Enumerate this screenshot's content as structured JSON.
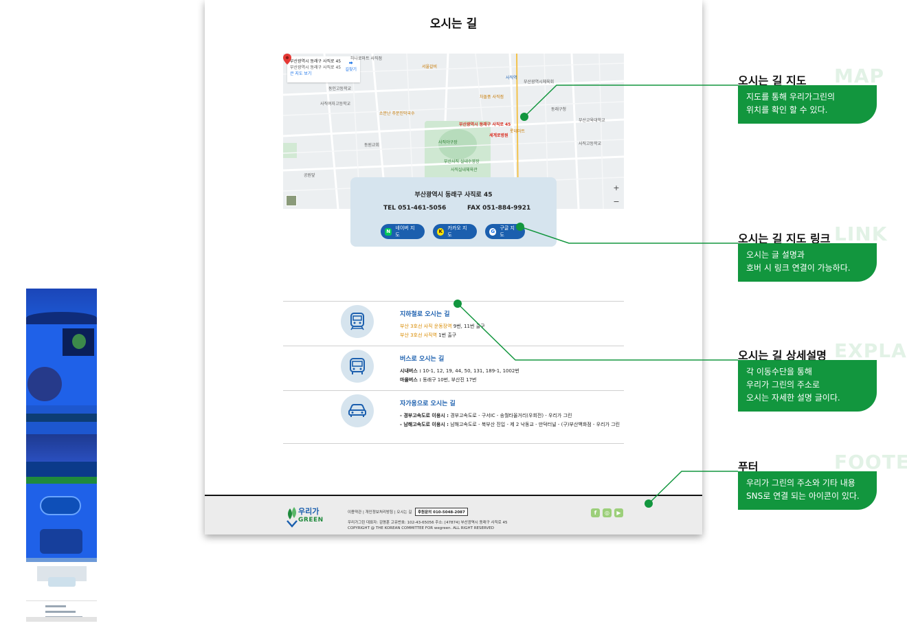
{
  "page": {
    "title": "오시는 길",
    "map": {
      "address_box": {
        "line1": "부산광역시 동래구 사직로 45",
        "line2": "부산광역시 동래구 사직로 45",
        "larger_map": "큰 지도 보기",
        "directions": "길찾기"
      },
      "labels": {
        "pin": "부산광역시 동래구 사직로 45",
        "a": "하나로마트 사직점",
        "b": "사직여자고등학교",
        "c": "동인고등학교",
        "d": "사직역",
        "e": "사직야구장",
        "f": "부산사직 실내수영장",
        "g": "사직실내체육관",
        "h": "세계로병원",
        "i": "서울갈비",
        "j": "차돌풍 사직점",
        "k": "소문난 주문진막국수",
        "l": "부산교육대학교",
        "m": "동래구청",
        "n": "부산광역시체육회",
        "o": "롯데마트",
        "p": "사직고등학교",
        "q": "공원앞",
        "r": "동원교회"
      },
      "zoom_in": "+",
      "zoom_out": "−"
    },
    "info": {
      "address": "부산광역시 동래구 사직로 45",
      "tel": "TEL 051-461-5056",
      "fax": "FAX 051-884-9921",
      "buttons": {
        "naver": "네이버 지도",
        "naver_icon": "N",
        "kakao": "카카오 지도",
        "kakao_icon": "K",
        "google": "구글 지도",
        "google_icon": "G"
      }
    },
    "routes": {
      "subway": {
        "title": "지하철로 오시는 길",
        "line1_hl": "부산 3호선 사직 운동장역",
        "line1_rest": " 9번, 11번 출구",
        "line2_hl": "부산 3호선 사직역",
        "line2_rest": " 1번 출구"
      },
      "bus": {
        "title": "버스로 오시는 길",
        "line1_label": "시내버스 :",
        "line1_rest": " 10-1, 12, 19, 44, 50, 131, 189-1, 1002번",
        "line2_label": "마을버스 :",
        "line2_rest": " 동래구 10번, 부산진 17번"
      },
      "car": {
        "title": "자가용으로 오시는 길",
        "line1_label": "- 경부고속도로 이용시 :",
        "line1_rest": " 경부고속도로 - 구서IC - 송월타올거리(우회전) - 우리가 그린",
        "line2_label": "- 남해고속도로 이용시 :",
        "line2_rest": " 남해고속도로 - 북부산 진입 - 제 2 낙동교 - 만덕터널 - (구)부산백화점 - 우리가 그린"
      }
    },
    "footer": {
      "logo_line1": "우리가",
      "logo_line2": "GREEN",
      "links": "이용약관 | 개인정보처리방침 | 오시는 길",
      "phone": "후원문의 010-5048-2087",
      "address": "우리가그린  대표자: 김명훈  고유번호: 102-43-65056  주소: [47874]  부산광역시 동래구 사직로 45",
      "copyright": "COPYRIGHT @ THE KOREAN COMMITTEE FOR wegreen. ALL RIGHT RESERVED",
      "sns": {
        "facebook": "f",
        "instagram": "◎",
        "youtube": "▶"
      }
    }
  },
  "annotations": [
    {
      "title": "오시는 길 지도",
      "bg_word": "MAP",
      "lines": [
        "지도를 통해 우리가그린의",
        "위치를 확인 할 수 있다."
      ]
    },
    {
      "title": "오시는 길 지도 링크",
      "bg_word": "LINK",
      "lines": [
        "오시는 글 설명과",
        "호버 시 링크 연결이 가능하다."
      ]
    },
    {
      "title": "오시는 길 상세설명",
      "bg_word": "EXPLAIN",
      "lines": [
        "각 이동수단을 통해",
        "우리가 그린의 주소로",
        "오시는 자세한 설명 글이다."
      ]
    },
    {
      "title": "푸터",
      "bg_word": "FOOTER",
      "lines": [
        "우리가 그린의 주소와 기타 내용",
        " SNS로 연결 되는 아이콘이 있다."
      ]
    }
  ],
  "colors": {
    "accent_green": "#12963e",
    "brand_blue": "#1b5fae",
    "card_bg": "#d6e4ee",
    "highlight": "#d98b00"
  }
}
